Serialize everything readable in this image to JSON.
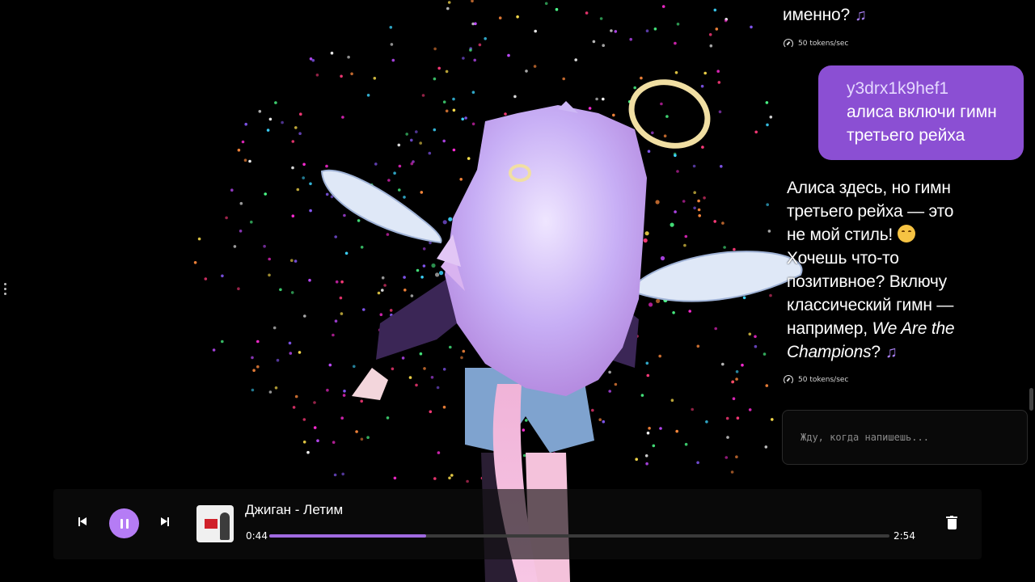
{
  "chat": {
    "ai_fragment": "именно?",
    "speed_1": "50 tokens/sec",
    "user": {
      "name": "y3drx1k9hef1",
      "text": "алиса включи гимн третьего рейха"
    },
    "ai_reply": {
      "part1": "Алиса здесь, но гимн третьего рейха — это не мой стиль!",
      "part2": "Хочешь что-то позитивное? Включу классический гимн — например,",
      "italic": "We Are the Champions",
      "part3": "?"
    },
    "speed_2": "50 tokens/sec",
    "input_placeholder": "Жду, когда напишешь..."
  },
  "icons": {
    "music_note": "music-note-icon",
    "grin_emoji": "grinning-sweat-emoji",
    "speedometer": "speedometer-icon",
    "prev": "skip-previous-icon",
    "pause": "pause-icon",
    "next": "skip-next-icon",
    "trash": "trash-icon"
  },
  "player": {
    "track": "Джиган - Летим",
    "current_time": "0:44",
    "total_time": "2:54",
    "progress_fraction": 0.2529
  },
  "colors": {
    "accent": "#b57cf5",
    "bubble": "#8b4fd3",
    "progress_fill": "#a06ae0"
  }
}
